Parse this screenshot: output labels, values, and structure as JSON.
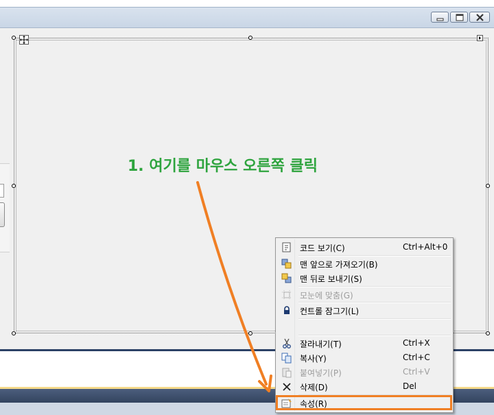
{
  "window": {
    "minimize_icon": "minimize-icon",
    "maximize_icon": "maximize-icon",
    "close_icon": "close-icon"
  },
  "annotation": {
    "text": "1. 여기를 마우스 오른쪽 클릭",
    "color": "#2ea43e",
    "arrow_color": "#f07f24"
  },
  "context_menu": {
    "items": [
      {
        "icon": "view-code-icon",
        "label": "코드 보기(C)",
        "shortcut": "Ctrl+Alt+0",
        "enabled": true
      },
      {
        "icon": "bring-to-front-icon",
        "label": "맨 앞으로 가져오기(B)",
        "shortcut": "",
        "enabled": true
      },
      {
        "icon": "send-to-back-icon",
        "label": "맨 뒤로 보내기(S)",
        "shortcut": "",
        "enabled": true
      },
      {
        "icon": "align-to-grid-icon",
        "label": "모눈에 맞춤(G)",
        "shortcut": "",
        "enabled": false
      },
      {
        "icon": "lock-icon",
        "label": "컨트롤 잠그기(L)",
        "shortcut": "",
        "enabled": true
      },
      {
        "icon": "cut-icon",
        "label": "잘라내기(T)",
        "shortcut": "Ctrl+X",
        "enabled": true
      },
      {
        "icon": "copy-icon",
        "label": "복사(Y)",
        "shortcut": "Ctrl+C",
        "enabled": true
      },
      {
        "icon": "paste-icon",
        "label": "붙여넣기(P)",
        "shortcut": "Ctrl+V",
        "enabled": false
      },
      {
        "icon": "delete-icon",
        "label": "삭제(D)",
        "shortcut": "Del",
        "enabled": true
      },
      {
        "icon": "properties-icon",
        "label": "속성(R)",
        "shortcut": "",
        "enabled": true,
        "highlighted": true
      }
    ],
    "highlight_color": "#f07f24"
  }
}
